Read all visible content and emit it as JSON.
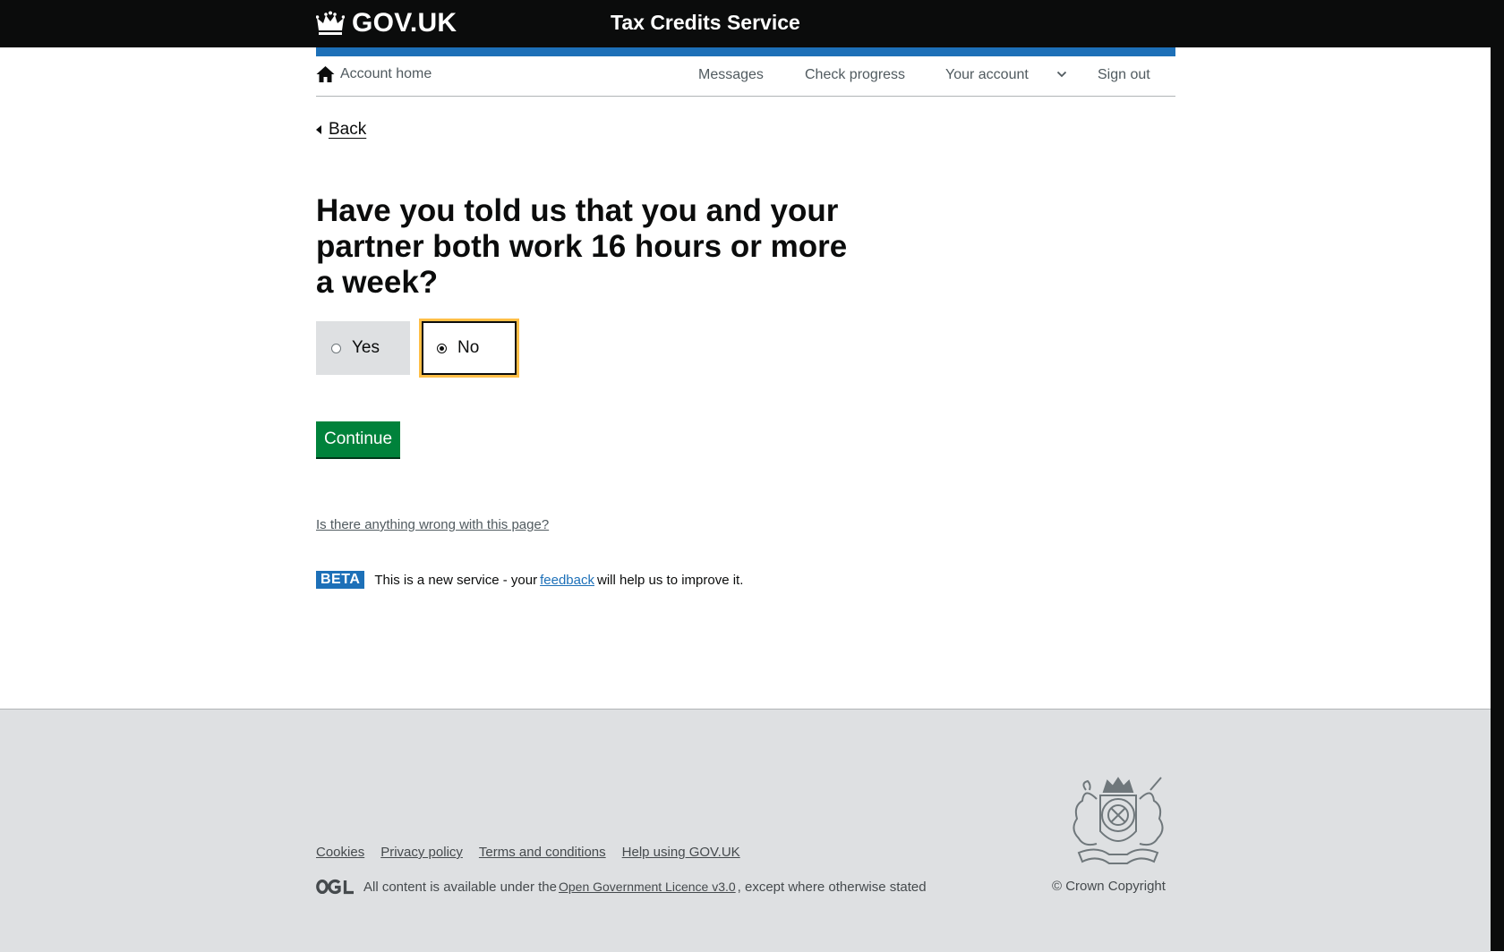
{
  "header": {
    "logo_text": "GOV.UK",
    "service_name": "Tax Credits Service"
  },
  "account_nav": {
    "home_label": "Account home",
    "items": [
      {
        "label": "Messages"
      },
      {
        "label": "Check progress"
      },
      {
        "label": "Your account"
      },
      {
        "label": "Sign out"
      }
    ]
  },
  "back_label": "Back",
  "question": {
    "heading": "Have you told us that you and your partner both work 16 hours or more a week?",
    "options": [
      {
        "label": "Yes",
        "checked": false
      },
      {
        "label": "No",
        "checked": true
      }
    ]
  },
  "continue_label": "Continue",
  "report_link": "Is there anything wrong with this page?",
  "beta": {
    "tag": "BETA",
    "text_before": "This is a new service  - your",
    "link": "feedback",
    "text_after": "will help us to improve it."
  },
  "footer": {
    "links": [
      "Cookies",
      "Privacy policy",
      "Terms and conditions",
      "Help using GOV.UK"
    ],
    "licence_before": "All content is available under the",
    "licence_link": "Open Government Licence v3.0",
    "licence_after": ", except where otherwise stated",
    "copyright": "© Crown Copyright"
  },
  "colors": {
    "header_bg": "#0b0c0c",
    "brand_blue": "#1d70b8",
    "button_green": "#00823b",
    "focus_yellow": "#ffbf47",
    "footer_bg": "#dee0e2"
  },
  "icons": [
    "crown-icon",
    "home-icon",
    "chevron-down-icon",
    "back-arrow-icon",
    "ogl-logo-icon",
    "royal-crest-icon"
  ]
}
